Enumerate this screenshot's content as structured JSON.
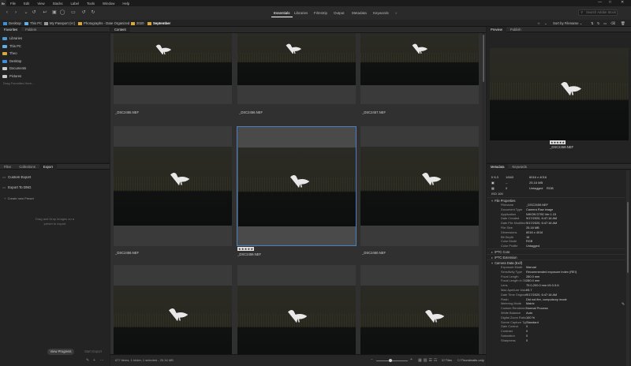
{
  "menubar": {
    "logo": "Br",
    "items": [
      "File",
      "Edit",
      "View",
      "Stacks",
      "Label",
      "Tools",
      "Window",
      "Help"
    ]
  },
  "toolbar": {
    "workspaces": [
      "Essentials",
      "Libraries",
      "Filmstrip",
      "Output",
      "Metadata",
      "Keywords"
    ],
    "active_workspace": "Essentials",
    "search_placeholder": "Search Adobe Stock",
    "sort_label": "Sort by Filename",
    "icons": [
      "back-icon",
      "forward-icon",
      "recent-icon",
      "boomerang-icon",
      "camera-icon",
      "refine-icon",
      "open-recent-icon",
      "rotate-left-icon",
      "rotate-right-icon"
    ]
  },
  "path": {
    "crumbs": [
      "Desktop",
      "This PC",
      "My Passport (H:)",
      "Photographs - Date Organized",
      "2020",
      "September"
    ]
  },
  "left": {
    "top_tabs": [
      "Favorites",
      "Folders"
    ],
    "favorites": [
      {
        "label": "Libraries",
        "color": "#4a9ad6"
      },
      {
        "label": "This PC",
        "color": "#5fb0e8"
      },
      {
        "label": "Theo",
        "color": "#d6a93e"
      },
      {
        "label": "Desktop",
        "color": "#3c8fd8"
      },
      {
        "label": "Documents",
        "color": "#c9c9c9"
      },
      {
        "label": "Pictures",
        "color": "#c9c9c9"
      }
    ],
    "drag_hint": "Drag Favorites Here...",
    "bottom_tabs": [
      "Filter",
      "Collections",
      "Export"
    ],
    "active_bottom_tab": "Export",
    "export_items": [
      "Custom Export",
      "Export To DNG"
    ],
    "create_preset": "Create new Preset",
    "export_hint_1": "Drag and Drop images on a",
    "export_hint_2": "preset to export",
    "view_progress": "View Progress",
    "start_export": "Start Export"
  },
  "content": {
    "tab": "Content",
    "files": [
      "_DSC2455.NEF",
      "_DSC2456.NEF",
      "_DSC2457.NEF",
      "_DSC2458.NEF",
      "_DSC2459.NEF",
      "_DSC2460.NEF",
      "",
      "",
      ""
    ],
    "selected_index": 4,
    "rating": "★★★★★",
    "status_text": "677 items, 1 folder, 1 selected - 25.16 MB",
    "tiles_label": "Tiles",
    "thumbs_only_label": "Thumbnails only"
  },
  "preview": {
    "tabs": [
      "Preview",
      "Publish"
    ],
    "filename": "_DSC2459.NEF",
    "rating": "★★★★★"
  },
  "metadata": {
    "tabs": [
      "Metadata",
      "Keywords"
    ],
    "summary": {
      "aperture": "f/ 6.3",
      "shutter": "1/640",
      "dims": "6016 x 4016",
      "size": "25.16 MB",
      "dash": "--",
      "iso": "ISO 100",
      "colorspace": "RGB",
      "profile": "Untagged",
      "wb": "Auto",
      "label": "Untagged",
      "ev": "0"
    },
    "file_properties_title": "File Properties",
    "file_properties": [
      {
        "k": "Filename",
        "v": "_DSC2459.NEF"
      },
      {
        "k": "Document Type",
        "v": "Camera Raw image"
      },
      {
        "k": "Application",
        "v": "NIKON D750 Ver.1.15"
      },
      {
        "k": "Date Created",
        "v": "9/17/2020, 6:47:16 AM"
      },
      {
        "k": "Date File Modified",
        "v": "9/17/2020, 6:47:16 AM"
      },
      {
        "k": "File Size",
        "v": "25.16 MB"
      },
      {
        "k": "Dimensions",
        "v": "6016 x 4016"
      },
      {
        "k": "Bit Depth",
        "v": "16"
      },
      {
        "k": "Color Mode",
        "v": "RGB"
      },
      {
        "k": "Color Profile",
        "v": "Untagged"
      }
    ],
    "sections": [
      "IPTC Core",
      "IPTC Extension",
      "Camera Data (Exif)"
    ],
    "exif": [
      {
        "k": "Exposure Mode",
        "v": "Manual"
      },
      {
        "k": "Sensitivity Type",
        "v": "Recommended exposure index (REI)"
      },
      {
        "k": "Focal Length",
        "v": "280.0 mm"
      },
      {
        "k": "Focal Length in 35mm Film",
        "v": "280.0 mm"
      },
      {
        "k": "Lens",
        "v": "70.0-200.0 mm f/4.0-5.6"
      },
      {
        "k": "Max Aperture Value",
        "v": "f/5.7"
      },
      {
        "k": "Date Time Original",
        "v": "9/17/2020, 6:47:16 AM"
      },
      {
        "k": "Flash",
        "v": "Did not fire, compulsory mode"
      },
      {
        "k": "Metering Mode",
        "v": "Matrix"
      },
      {
        "k": "Custom Rendered",
        "v": "Normal Process"
      },
      {
        "k": "White Balance",
        "v": "Auto"
      },
      {
        "k": "Digital Zoom Ratio",
        "v": "100 %"
      },
      {
        "k": "Scene Capture Type",
        "v": "Standard"
      },
      {
        "k": "Gain Control",
        "v": "0"
      },
      {
        "k": "Contrast",
        "v": "0"
      },
      {
        "k": "Saturation",
        "v": "0"
      },
      {
        "k": "Sharpness",
        "v": "0"
      }
    ]
  },
  "colors": {
    "accent_selected": "#4d7fc0",
    "folder": "#d6a93e"
  }
}
